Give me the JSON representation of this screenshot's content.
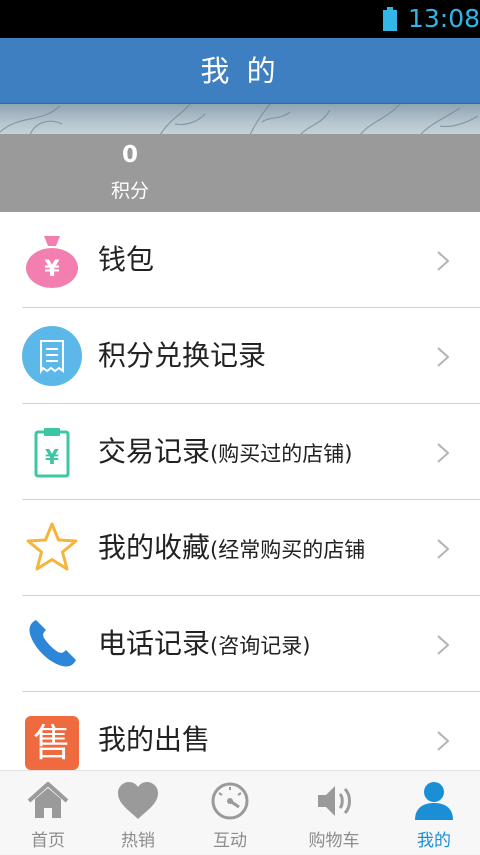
{
  "status_bar": {
    "time": "13:08"
  },
  "header": {
    "title": "我 的"
  },
  "points": {
    "value": "0",
    "label": "积分"
  },
  "menu": {
    "items": [
      {
        "label": "钱包",
        "note": ""
      },
      {
        "label": "积分兑换记录",
        "note": ""
      },
      {
        "label": "交易记录",
        "note": "(购买过的店铺)"
      },
      {
        "label": "我的收藏",
        "note": "(经常购买的店铺"
      },
      {
        "label": "电话记录",
        "note": "(咨询记录)"
      },
      {
        "label": "我的出售",
        "note": ""
      }
    ],
    "sale_icon_text": "售"
  },
  "tabs": [
    {
      "label": "首页",
      "icon": "home-icon"
    },
    {
      "label": "热销",
      "icon": "heart-icon"
    },
    {
      "label": "互动",
      "icon": "dial-icon"
    },
    {
      "label": "购物车",
      "icon": "speaker-icon"
    },
    {
      "label": "我的",
      "icon": "person-icon",
      "active": true
    }
  ],
  "colors": {
    "header_bg": "#3d7fc1",
    "active_tab": "#1b8fd6",
    "status_text": "#33b5e5",
    "points_bg": "#9a9a9a"
  }
}
